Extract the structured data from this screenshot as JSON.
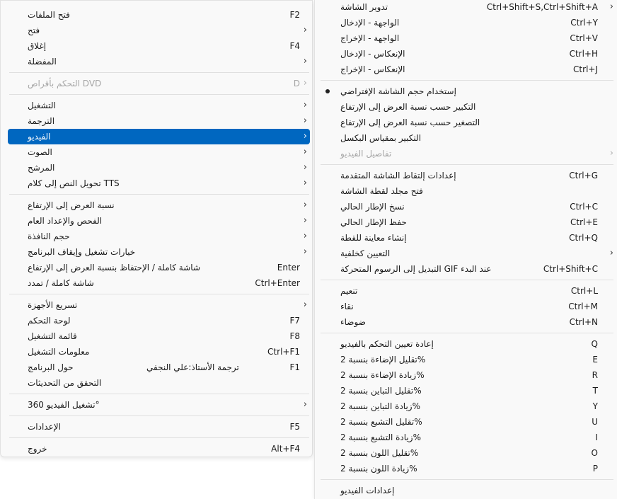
{
  "main_menu": {
    "items": [
      {
        "label": "فتح الملفات",
        "shortcut": "F2",
        "submenu": false
      },
      {
        "label": "فتح",
        "shortcut": "",
        "submenu": true
      },
      {
        "label": "إغلاق",
        "shortcut": "F4",
        "submenu": false
      },
      {
        "label": "المفضلة",
        "shortcut": "",
        "submenu": true
      },
      {
        "label": "التحكم بأقراص DVD",
        "shortcut": "D",
        "submenu": true,
        "disabled": true
      },
      {
        "label": "التشغيل",
        "shortcut": "",
        "submenu": true
      },
      {
        "label": "الترجمة",
        "shortcut": "",
        "submenu": true
      },
      {
        "label": "الفيديو",
        "shortcut": "",
        "submenu": true,
        "highlighted": true
      },
      {
        "label": "الصوت",
        "shortcut": "",
        "submenu": true
      },
      {
        "label": "المرشح",
        "shortcut": "",
        "submenu": true
      },
      {
        "label": "تحويل النص إلى كلام TTS",
        "shortcut": "",
        "submenu": true
      },
      {
        "label": "نسبة العرض إلى الإرتفاع",
        "shortcut": "",
        "submenu": true
      },
      {
        "label": "الفحص والإعداد العام",
        "shortcut": "",
        "submenu": true
      },
      {
        "label": "حجم النافذة",
        "shortcut": "",
        "submenu": true
      },
      {
        "label": "خيارات تشغيل وإيقاف البرنامج",
        "shortcut": "",
        "submenu": true
      },
      {
        "label": "شاشة كاملة / الإحتفاظ بنسبة العرض إلى الإرتفاع",
        "shortcut": "Enter",
        "submenu": false
      },
      {
        "label": "شاشة كاملة / تمدد",
        "shortcut": "Ctrl+Enter",
        "submenu": false
      },
      {
        "label": "تسريع الأجهزة",
        "shortcut": "",
        "submenu": true
      },
      {
        "label": "لوحة التحكم",
        "shortcut": "F7",
        "submenu": false
      },
      {
        "label": "قائمة التشغيل",
        "shortcut": "F8",
        "submenu": false
      },
      {
        "label": "معلومات التشغيل",
        "shortcut": "Ctrl+F1",
        "submenu": false
      },
      {
        "label": "حول البرنامج",
        "shortcut": "F1",
        "submenu": false,
        "credit": "ترجمة الأستاذ:علي النجفي"
      },
      {
        "label": "التحقق من التحديثات",
        "shortcut": "",
        "submenu": false
      },
      {
        "label": "تشغيل الفيديو 360°",
        "shortcut": "",
        "submenu": true
      },
      {
        "label": "الإعدادات",
        "shortcut": "F5",
        "submenu": false
      },
      {
        "label": "خروج",
        "shortcut": "Alt+F4",
        "submenu": false
      }
    ]
  },
  "video_submenu": {
    "items": [
      {
        "label": "تدوير الشاشة",
        "shortcut": "Ctrl+Shift+S,Ctrl+Shift+A",
        "submenu": true
      },
      {
        "label": "الواجهة - الإدخال",
        "shortcut": "Ctrl+Y"
      },
      {
        "label": "الواجهة - الإخراج",
        "shortcut": "Ctrl+V"
      },
      {
        "label": "الإنعكاس - الإدخال",
        "shortcut": "Ctrl+H"
      },
      {
        "label": "الإنعكاس - الإخراج",
        "shortcut": "Ctrl+J"
      },
      {
        "label": "إستخدام حجم الشاشة الإفتراضي",
        "shortcut": "",
        "checked": true
      },
      {
        "label": "التكبير حسب نسبة العرض إلى الإرتفاع",
        "shortcut": ""
      },
      {
        "label": "التصغير حسب نسبة العرض إلى الإرتفاع",
        "shortcut": ""
      },
      {
        "label": "التكبير بمقياس البكسل",
        "shortcut": ""
      },
      {
        "label": "تفاصيل الفيديو",
        "shortcut": "",
        "submenu": true,
        "disabled": true
      },
      {
        "label": "إعدادات إلتقاط الشاشة المتقدمة",
        "shortcut": "Ctrl+G"
      },
      {
        "label": "فتح مجلد لقطة الشاشة",
        "shortcut": ""
      },
      {
        "label": "نسخ الإطار الحالي",
        "shortcut": "Ctrl+C"
      },
      {
        "label": "حفظ الإطار الحالي",
        "shortcut": "Ctrl+E"
      },
      {
        "label": "إنشاء معاينة للقطة",
        "shortcut": "Ctrl+Q"
      },
      {
        "label": "التعيين كخلفية",
        "shortcut": "",
        "submenu": true
      },
      {
        "label": "التبديل إلى الرسوم المتحركة GIF عند البدء",
        "shortcut": "Ctrl+Shift+C"
      },
      {
        "label": "تنعيم",
        "shortcut": "Ctrl+L"
      },
      {
        "label": "نقاء",
        "shortcut": "Ctrl+M"
      },
      {
        "label": "ضوضاء",
        "shortcut": "Ctrl+N"
      },
      {
        "label": "إعادة تعيين التحكم بالفيديو",
        "shortcut": "Q"
      },
      {
        "label": "تقليل الإضاءة بنسبة 2%",
        "shortcut": "E"
      },
      {
        "label": "زيادة الإضاءة بنسبة 2%",
        "shortcut": "R"
      },
      {
        "label": "تقليل التباين بنسبة 2%",
        "shortcut": "T"
      },
      {
        "label": "زيادة التباين بنسبة 2%",
        "shortcut": "Y"
      },
      {
        "label": "تقليل التشبع بنسبة 2%",
        "shortcut": "U"
      },
      {
        "label": "زيادة التشبع بنسبة 2%",
        "shortcut": "I"
      },
      {
        "label": "تقليل اللون بنسبة 2%",
        "shortcut": "O"
      },
      {
        "label": "زيادة اللون بنسبة 2%",
        "shortcut": "P"
      },
      {
        "label": "إعدادات الفيديو",
        "shortcut": ""
      }
    ]
  },
  "icons": {
    "submenu_arrow": "chevron-right-icon",
    "check_mark": "bullet-dot-icon"
  },
  "colors": {
    "highlight": "#0067c0",
    "menu_bg": "#f9f9f9",
    "disabled_text": "#a6a6a6"
  }
}
